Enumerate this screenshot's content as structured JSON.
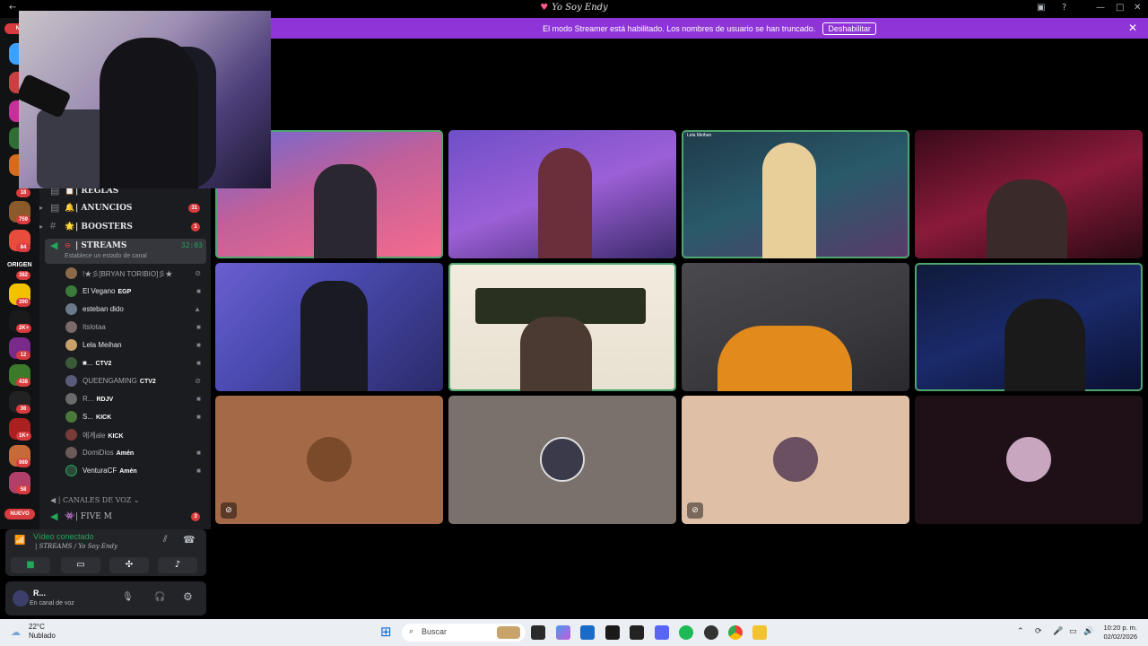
{
  "window": {
    "title": "Yo Soy Endy"
  },
  "banner": {
    "message": "El modo Streamer está habilitado. Los nombres de usuario se han truncado.",
    "disable_label": "Deshabilitar"
  },
  "servers": {
    "nuevo_top": "NU",
    "badges": [
      "18",
      "759",
      "84",
      "382",
      "390",
      "2K+",
      "12",
      "438",
      "36",
      "1K+",
      "989",
      "58"
    ],
    "nuevo_bottom": "NUEVO",
    "origen_label": "ORIGEN"
  },
  "channels": [
    {
      "icon": "lock",
      "emoji": "📋",
      "name": "| REGLAS",
      "badge": ""
    },
    {
      "icon": "bell",
      "emoji": "🔔",
      "name": "| ANUNCIOS",
      "badge": "31"
    },
    {
      "icon": "hash",
      "emoji": "🌟",
      "name": "| BOOSTERS",
      "badge": "1"
    }
  ],
  "stream_channel": {
    "name": "| STREAMS",
    "timer": "32:03",
    "status_prompt": "Establece un estado de canal"
  },
  "voice_users": [
    {
      "name": "!★彡[BRYAN TORIBIO]彡★",
      "tag": "",
      "dim": true,
      "icon": "mute"
    },
    {
      "name": "El Vegano",
      "tag": "EGP",
      "dim": false,
      "icon": "video"
    },
    {
      "name": "esteban dido",
      "tag": "",
      "dim": false,
      "icon": "live"
    },
    {
      "name": "Itslotaa",
      "tag": "",
      "dim": true,
      "icon": "video"
    },
    {
      "name": "Lela Meihan",
      "tag": "",
      "dim": false,
      "icon": "video"
    },
    {
      "name": "■...",
      "tag": "CTV2",
      "dim": false,
      "icon": "video"
    },
    {
      "name": "QUEENGAMING",
      "tag": "CTV2",
      "dim": true,
      "icon": "mute"
    },
    {
      "name": "R...",
      "tag": "RDJV",
      "dim": true,
      "icon": "video"
    },
    {
      "name": "S...",
      "tag": "KICK",
      "dim": false,
      "icon": "video"
    },
    {
      "name": "에게ale",
      "tag": "KICK",
      "dim": true,
      "icon": ""
    },
    {
      "name": "DomiDios",
      "tag": "Amén",
      "dim": true,
      "icon": "video"
    },
    {
      "name": "VenturaCF",
      "tag": "Amén",
      "dim": false,
      "icon": "video"
    }
  ],
  "voice_category": "| CANALES DE VOZ",
  "five_m": {
    "name": "| FIVE M",
    "badge": "3"
  },
  "voice_panel": {
    "status": "Vídeo conectado",
    "channel": "| STREAMS / Yo Soy Endy"
  },
  "user_panel": {
    "name": "R...",
    "status": "En canal de voz"
  },
  "tiles": [
    {
      "label": "",
      "speaking": true
    },
    {
      "label": "",
      "speaking": false
    },
    {
      "label": "Lela Meihan",
      "speaking": true
    },
    {
      "label": "",
      "speaking": false
    },
    {
      "label": "",
      "speaking": false
    },
    {
      "label": "",
      "speaking": true
    },
    {
      "label": "",
      "speaking": false
    },
    {
      "label": "",
      "speaking": true
    },
    {
      "label": "",
      "speaking": false
    },
    {
      "label": "",
      "speaking": false
    },
    {
      "label": "",
      "speaking": false
    },
    {
      "label": "",
      "speaking": false
    }
  ],
  "taskbar": {
    "temperature": "22°C",
    "condition": "Nublado",
    "search_placeholder": "Buscar",
    "time": "10:20 p. m.",
    "date": "02/02/2026"
  },
  "colors": {
    "accent": "#8f35d8",
    "speaking": "#4fa56e",
    "badge": "#d83c3e",
    "connected": "#23a55a"
  }
}
